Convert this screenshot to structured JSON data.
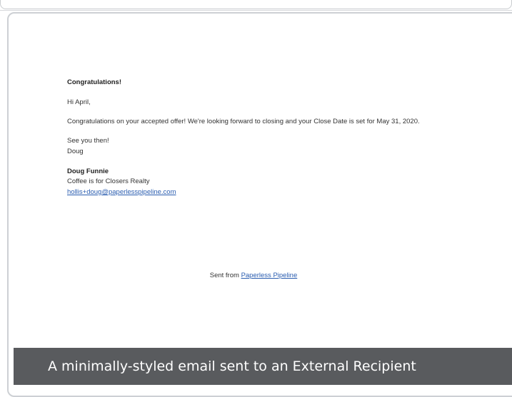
{
  "email": {
    "heading": "Congratulations!",
    "salutation": "Hi April,",
    "body": "Congratulations on your accepted offer! We're looking forward to closing and your Close Date is set for May 31, 2020.",
    "closing_line": "See you then!",
    "closing_name": "Doug",
    "signature": {
      "name": "Doug Funnie",
      "company": "Coffee is for Closers Realty",
      "email": "hollis+doug@paperlesspipeline.com"
    },
    "footer": {
      "prefix": "Sent from ",
      "link_text": "Paperless Pipeline"
    }
  },
  "caption": "A minimally-styled email sent to an External Recipient",
  "colors": {
    "link": "#2a5db0",
    "caption_bg": "#595b5e",
    "frame_border": "#cdd0d4"
  }
}
